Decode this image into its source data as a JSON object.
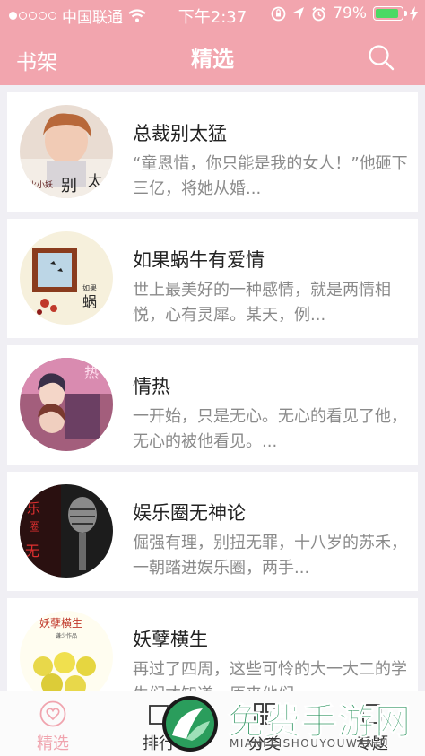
{
  "status_bar": {
    "carrier": "中国联通",
    "time": "下午2:37",
    "battery_percent": "79%",
    "battery_level": 0.79
  },
  "nav": {
    "back_label": "书架",
    "title": "精选",
    "search_icon": "search-icon"
  },
  "books": [
    {
      "title": "总裁别太猛",
      "desc": "“童恩惜，你只能是我的女人！”他砸下三亿，将她从婚..."
    },
    {
      "title": "如果蜗牛有爱情",
      "desc": "世上最美好的一种感情，就是两情相悦，心有灵犀。某天，例..."
    },
    {
      "title": "情热",
      "desc": "一开始，只是无心。无心的看见了他，无心的被他看见。..."
    },
    {
      "title": "娱乐圈无神论",
      "desc": "倔强有理，别扭无罪，十八岁的苏禾，一朝踏进娱乐圈，两手..."
    },
    {
      "title": "妖孽横生",
      "desc": "再过了四周，这些可怜的大一大二的学生们才知道，原来他们..."
    }
  ],
  "tabbar": {
    "tabs": [
      {
        "label": "精选",
        "icon": "heart-icon",
        "active": true
      },
      {
        "label": "排行",
        "icon": "chart-icon",
        "active": false
      },
      {
        "label": "分类",
        "icon": "grid-icon",
        "active": false
      },
      {
        "label": "专题",
        "icon": "topic-icon",
        "active": false
      }
    ]
  },
  "watermark": {
    "title": "免费手游网",
    "subtitle": "MIANFEISHOUYOUWANG"
  },
  "colors": {
    "header_pink": "#f2a5ae",
    "active_tab": "#f0a4ae",
    "watermark_green": "#1e8d54"
  }
}
